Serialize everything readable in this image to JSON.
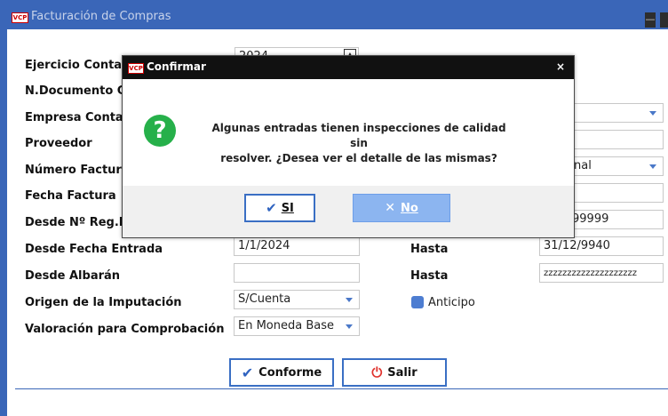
{
  "window": {
    "logo_text": "VCP",
    "title": "Facturación de Compras",
    "minimize_glyph": "—"
  },
  "form": {
    "fields": [
      {
        "label": "Ejercicio Contable",
        "value": "2024"
      },
      {
        "label": "N.Documento Contable",
        "value": ""
      },
      {
        "label": "Empresa Contable",
        "value": ""
      },
      {
        "label": "Proveedor",
        "value": ""
      },
      {
        "label": "Número Factura",
        "value": "nal"
      },
      {
        "label": "Fecha Factura",
        "value": ""
      },
      {
        "label": "Desde Nº Reg.Entrada",
        "value": "",
        "hasta_value": "99999"
      },
      {
        "label": "Desde Fecha Entrada",
        "value": "1/1/2024",
        "hasta_label": "Hasta",
        "hasta_value": "31/12/9940"
      },
      {
        "label": "Desde Albarán",
        "value": "",
        "hasta_label": "Hasta",
        "hasta_value": "zzzzzzzzzzzzzzzzzzzz"
      },
      {
        "label": "Origen de la Imputación",
        "value": "S/Cuenta"
      },
      {
        "label": "Valoración para Comprobación",
        "value": "En Moneda Base"
      }
    ],
    "anticipo_label": "Anticipo",
    "anticipo_checked": true
  },
  "buttons": {
    "conforme": "Conforme",
    "salir": "Salir"
  },
  "dialog": {
    "logo_text": "VCP",
    "title": "Confirmar",
    "close_glyph": "×",
    "icon_glyph": "?",
    "message_line1": "Algunas entradas tienen inspecciones de calidad sin",
    "message_line2": "resolver. ¿Desea ver el detalle de las mismas?",
    "yes_label": "SI",
    "no_label": "No"
  },
  "colors": {
    "titlebar": "#3a66b8",
    "accent": "#3a6fc4",
    "question_icon": "#26b04a",
    "no_button": "#8cb5f0"
  }
}
